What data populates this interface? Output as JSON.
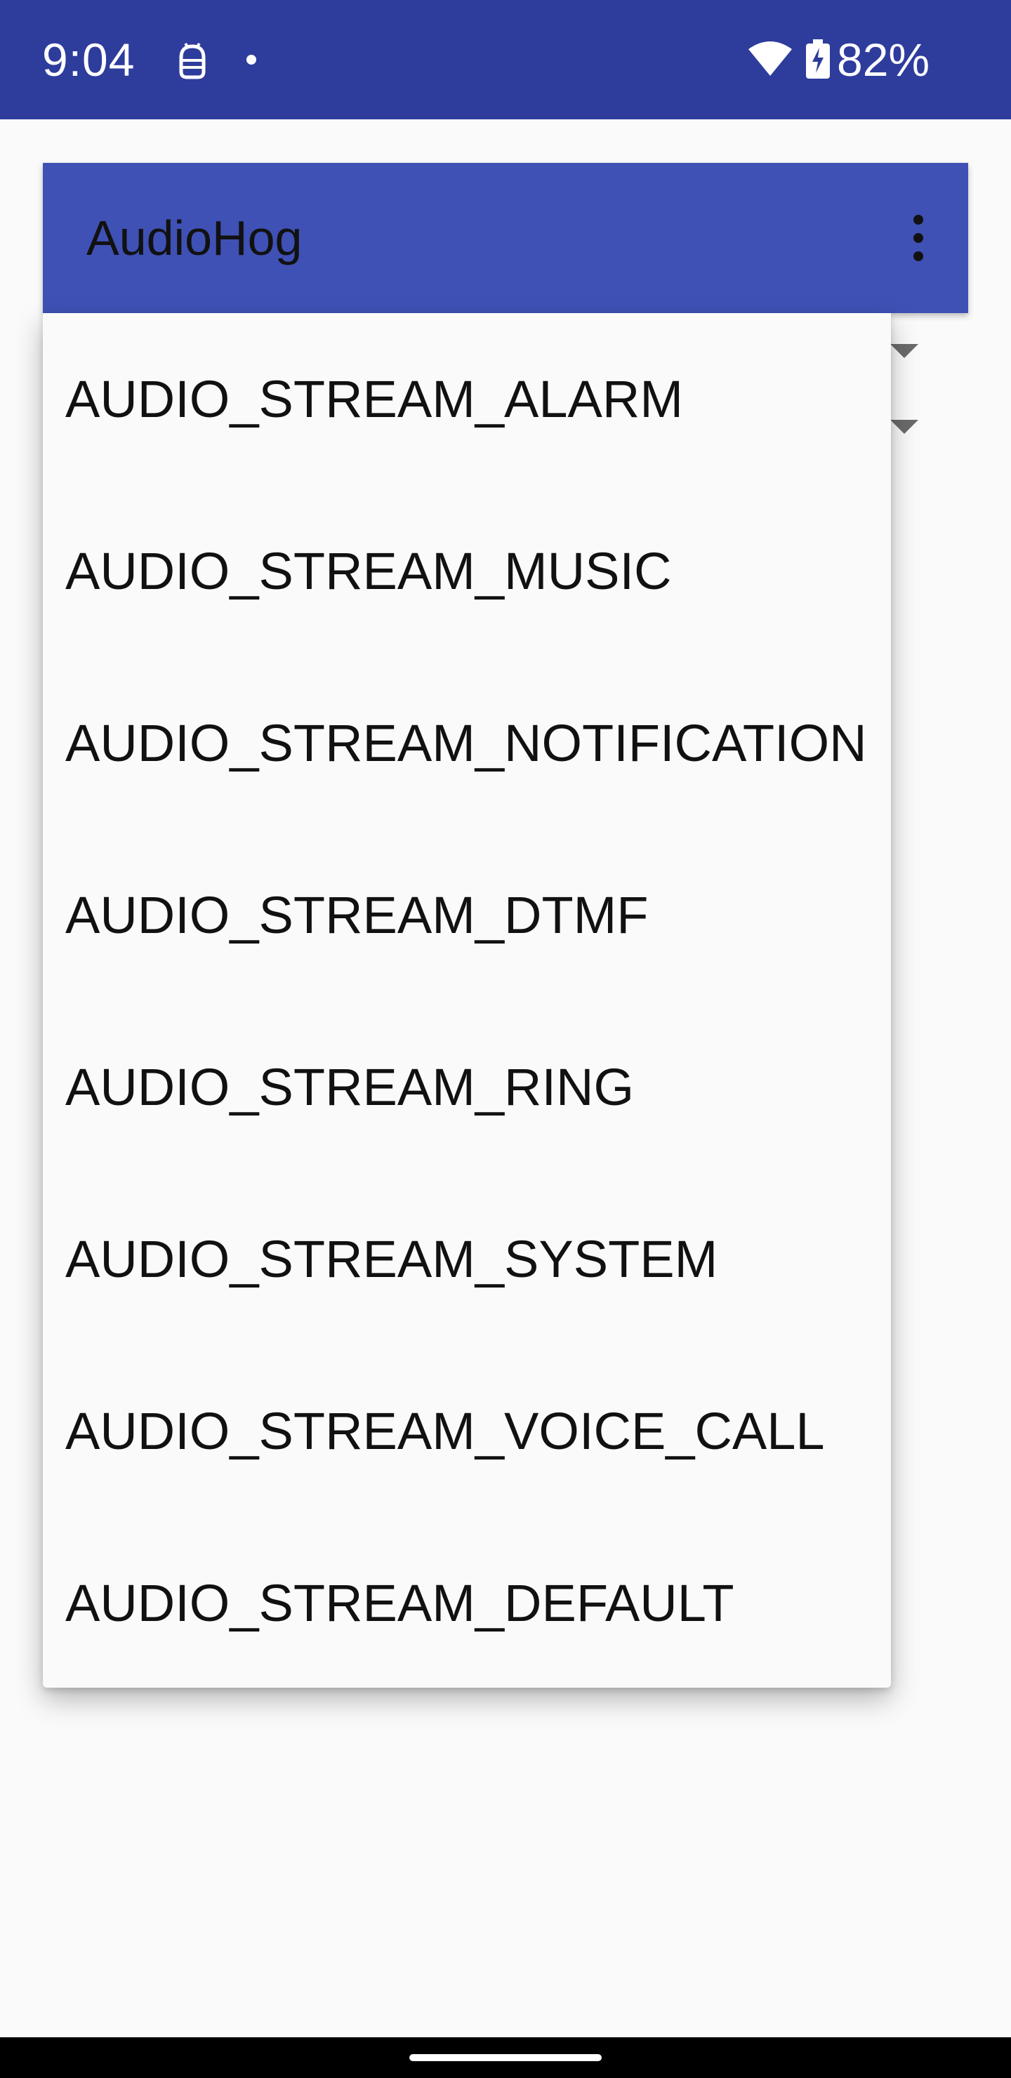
{
  "status_bar": {
    "time": "9:04",
    "battery": "82%",
    "icons": [
      "android-debug-icon",
      "notification-dot-icon",
      "wifi-icon",
      "battery-charging-icon"
    ]
  },
  "app_bar": {
    "title": "AudioHog",
    "overflow_icon": "more-vert-icon"
  },
  "dropdown": {
    "items": [
      {
        "label": "AUDIO_STREAM_ALARM"
      },
      {
        "label": "AUDIO_STREAM_MUSIC"
      },
      {
        "label": "AUDIO_STREAM_NOTIFICATION"
      },
      {
        "label": "AUDIO_STREAM_DTMF"
      },
      {
        "label": "AUDIO_STREAM_RING"
      },
      {
        "label": "AUDIO_STREAM_SYSTEM"
      },
      {
        "label": "AUDIO_STREAM_VOICE_CALL"
      },
      {
        "label": "AUDIO_STREAM_DEFAULT"
      }
    ]
  },
  "colors": {
    "status_bar": "#2e3c9c",
    "app_bar": "#3f51b5",
    "background": "#fafafa",
    "text": "#111111"
  }
}
